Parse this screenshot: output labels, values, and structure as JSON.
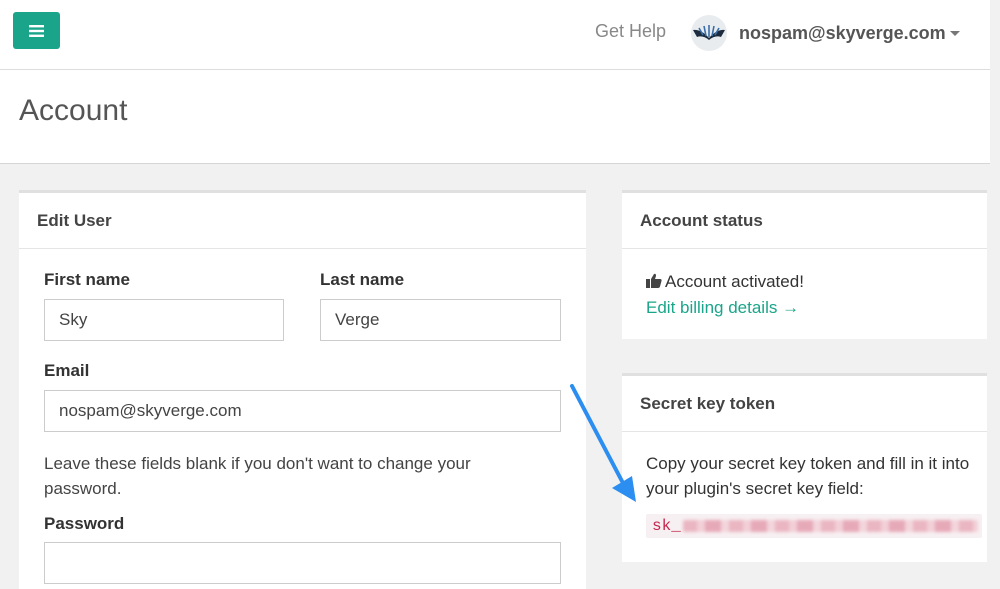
{
  "topbar": {
    "help_label": "Get Help",
    "user_email": "nospam@skyverge.com"
  },
  "header": {
    "title": "Account"
  },
  "edit_user": {
    "title": "Edit User",
    "first_name_label": "First name",
    "first_name_value": "Sky",
    "last_name_label": "Last name",
    "last_name_value": "Verge",
    "email_label": "Email",
    "email_value": "nospam@skyverge.com",
    "password_hint": "Leave these fields blank if you don't want to change your password.",
    "password_label": "Password",
    "password_value": ""
  },
  "account_status": {
    "title": "Account status",
    "status_text": "Account activated!",
    "billing_link": "Edit billing details →"
  },
  "secret_key": {
    "title": "Secret key token",
    "instructions": "Copy your secret key token and fill in it into your plugin's secret key field:",
    "token_prefix": "sk_"
  },
  "colors": {
    "accent": "#1aa58a",
    "token_text": "#c7254e",
    "arrow": "#2b8ef0"
  }
}
